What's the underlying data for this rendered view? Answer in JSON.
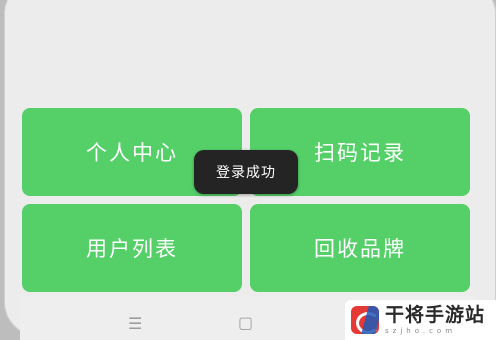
{
  "tiles": [
    {
      "label": "个人中心"
    },
    {
      "label": "扫码记录"
    },
    {
      "label": "用户列表"
    },
    {
      "label": "回收品牌"
    }
  ],
  "toast": {
    "text": "登录成功"
  },
  "nav": {
    "menu_glyph": "☰",
    "home_glyph": "▢"
  },
  "watermark": {
    "title": "干将手游站",
    "url": "szjho.com"
  },
  "colors": {
    "tile": "#55d069",
    "toast": "#242424",
    "screen": "#ececec"
  }
}
